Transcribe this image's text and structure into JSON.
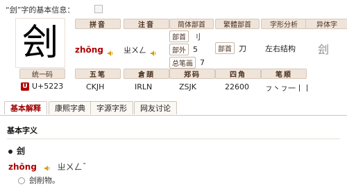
{
  "header": {
    "title": "“刽”字的基本信息："
  },
  "character": "刽",
  "labels": {
    "pinyin": "拼音",
    "zhuyin": "注音",
    "simplified_radical": "简体部首",
    "traditional_radical": "繁體部首",
    "structure": "字形分析",
    "variant": "异体字",
    "unicode": "统一码",
    "wubi": "五笔",
    "cangjie": "倉頡",
    "zhengma": "郑码",
    "sijiao": "四角",
    "stroke_order": "笔顺"
  },
  "values": {
    "pinyin": "zhōng",
    "zhuyin": "ㄓㄨㄥ",
    "radical_tag": "部首",
    "radical_value": "刂",
    "outside_tag": "部外",
    "outside_value": "5",
    "total_tag": "总笔画",
    "total_value": "7",
    "trad_tag": "部首",
    "trad_value": "刀",
    "structure": "左右结构",
    "variant_char": "刽",
    "unicode": "U+5223",
    "unicode_badge": "U",
    "wubi": "CKJH",
    "cangjie": "IRLN",
    "zhengma": "ZSJK",
    "sijiao": "22600",
    "stroke_order": "ㇷ丶ㇷ一丨丨"
  },
  "tabs": [
    {
      "label": "基本解释",
      "active": true
    },
    {
      "label": "康熙字典",
      "active": false
    },
    {
      "label": "字源字形",
      "active": false
    },
    {
      "label": "网友讨论",
      "active": false
    }
  ],
  "section": {
    "title": "基本字义"
  },
  "definition": {
    "bullet_char": "刽",
    "pinyin": "zhōng",
    "zhuyin": "ㄓㄨㄥˉ",
    "meaning": "刽削物。"
  },
  "colors": {
    "accent": "#b00000",
    "label_bg": "#efe4da",
    "label_border": "#d7c7b8"
  },
  "icons": {
    "speaker": "speaker-icon",
    "header": "info-icon",
    "unicode": "unicode-badge-icon"
  }
}
